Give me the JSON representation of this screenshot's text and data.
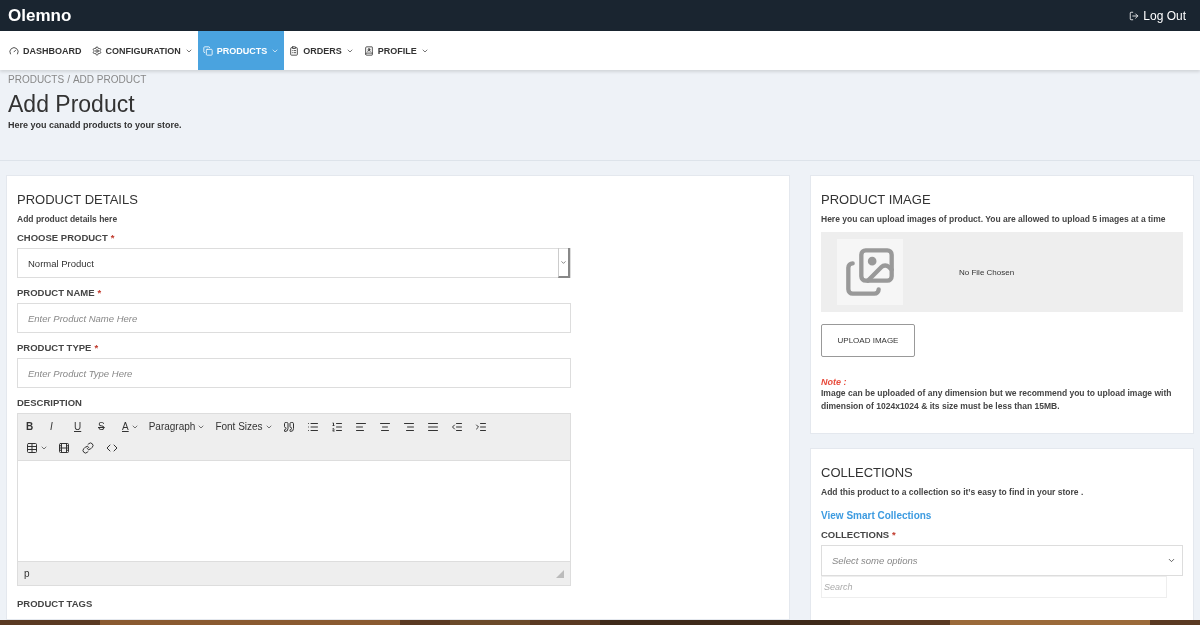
{
  "topbar": {
    "brand": "Olemno",
    "logout": "Log Out"
  },
  "nav": [
    {
      "kind": "dashboard",
      "label": "DASHBOARD",
      "dropdown": false,
      "selected": false
    },
    {
      "kind": "configuration",
      "label": "CONFIGURATION",
      "dropdown": true,
      "selected": false
    },
    {
      "kind": "products",
      "label": "PRODUCTS",
      "dropdown": true,
      "selected": true
    },
    {
      "kind": "orders",
      "label": "ORDERS",
      "dropdown": true,
      "selected": false
    },
    {
      "kind": "profile",
      "label": "PROFILE",
      "dropdown": true,
      "selected": false
    }
  ],
  "breadcrumb": [
    "PRODUCTS",
    "/",
    "ADD PRODUCT"
  ],
  "header": {
    "title": "Add Product",
    "subtitle": "Here you canadd products to your store."
  },
  "details": {
    "title": "PRODUCT DETAILS",
    "subtitle": "Add product details here",
    "fields": [
      {
        "kind": "select",
        "label": "CHOOSE PRODUCT",
        "mark": "*",
        "value": "Normal Product"
      },
      {
        "kind": "input",
        "label": "PRODUCT NAME",
        "mark": "*",
        "placeholder": "Enter Product Name Here"
      },
      {
        "kind": "input",
        "label": "PRODUCT TYPE",
        "mark": "*",
        "placeholder": "Enter Product Type Here"
      }
    ],
    "description": {
      "label": "DESCRIPTION",
      "status": "p",
      "toolbar": [
        [
          {
            "kind": "bold",
            "label": "B"
          },
          {
            "kind": "italic",
            "label": "I"
          },
          {
            "kind": "underline",
            "label": "U"
          },
          {
            "kind": "strike",
            "label": "S"
          },
          {
            "kind": "color",
            "label": "A"
          },
          {
            "kind": "dropdown",
            "label": "Paragraph"
          },
          {
            "kind": "dropdown",
            "label": "Font Sizes"
          },
          {
            "kind": "quote"
          },
          {
            "kind": "bullets"
          },
          {
            "kind": "numbers"
          },
          {
            "kind": "align-left"
          },
          {
            "kind": "align-center"
          },
          {
            "kind": "align-right"
          },
          {
            "kind": "justify"
          },
          {
            "kind": "outdent"
          },
          {
            "kind": "indent"
          }
        ],
        [
          {
            "kind": "table"
          },
          {
            "kind": "media"
          },
          {
            "kind": "link"
          },
          {
            "kind": "code"
          }
        ]
      ]
    },
    "tags_label": "PRODUCT TAGS"
  },
  "image": {
    "title": "PRODUCT IMAGE",
    "subtitle": "Here you can upload images of product. You are allowed to upload 5 images at a time",
    "file_status": "No File Chosen",
    "button": "UPLOAD IMAGE",
    "note_label": "Note :",
    "note": "Image can be uploaded of any dimension but we recommend you to upload image with dimension of 1024x1024 & its size must be less than 15MB."
  },
  "collections": {
    "title": "COLLECTIONS",
    "subtitle": "Add this product to a collection so it’s easy to find in your store .",
    "link": "View Smart Collections",
    "label": "COLLECTIONS",
    "mark": "*",
    "placeholder": "Select some options",
    "search_placeholder": "Search"
  }
}
